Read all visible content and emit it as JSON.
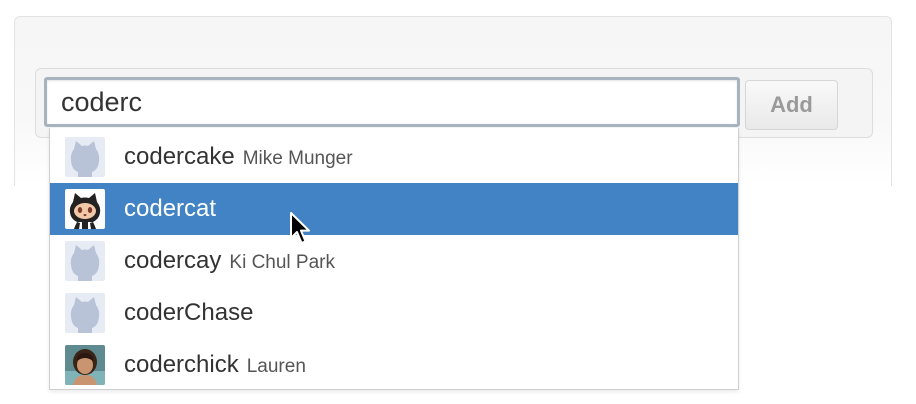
{
  "search": {
    "value": "coderc",
    "add_label": "Add"
  },
  "suggestions": [
    {
      "username": "codercake",
      "fullname": "Mike Munger",
      "avatar": "default-octocat-avatar",
      "selected": false
    },
    {
      "username": "codercat",
      "fullname": "",
      "avatar": "octocat-avatar",
      "selected": true
    },
    {
      "username": "codercay",
      "fullname": "Ki Chul Park",
      "avatar": "default-octocat-avatar",
      "selected": false
    },
    {
      "username": "coderChase",
      "fullname": "",
      "avatar": "default-octocat-avatar",
      "selected": false
    },
    {
      "username": "coderchick",
      "fullname": "Lauren",
      "avatar": "photo-avatar",
      "selected": false
    }
  ],
  "colors": {
    "selection": "#4183c4",
    "input_focus_border": "#a7b3bf",
    "default_avatar": "#b8c3d8"
  },
  "pointer": "arrow-cursor-icon"
}
